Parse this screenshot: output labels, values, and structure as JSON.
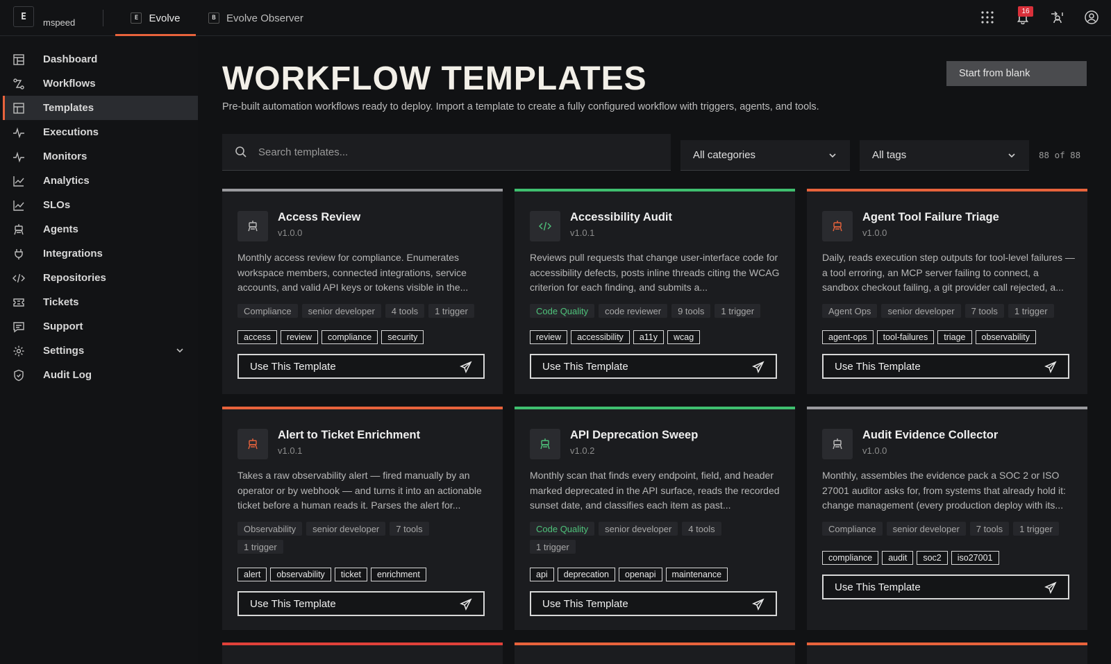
{
  "topbar": {
    "logo_text": "E",
    "org": "mspeed",
    "tabs": [
      {
        "label": "Evolve",
        "active": true
      },
      {
        "label": "Evolve Observer",
        "active": false
      }
    ],
    "notification_count": "16",
    "icons": [
      "apps-grid-icon",
      "bell-icon",
      "switch-user-icon",
      "account-icon"
    ]
  },
  "sidebar": {
    "items": [
      {
        "label": "Dashboard",
        "icon": "dashboard-icon"
      },
      {
        "label": "Workflows",
        "icon": "workflows-icon"
      },
      {
        "label": "Templates",
        "icon": "templates-icon",
        "active": true
      },
      {
        "label": "Executions",
        "icon": "pulse-icon"
      },
      {
        "label": "Monitors",
        "icon": "monitor-pulse-icon"
      },
      {
        "label": "Analytics",
        "icon": "chart-line-icon"
      },
      {
        "label": "SLOs",
        "icon": "chart-line-icon"
      },
      {
        "label": "Agents",
        "icon": "robot-icon"
      },
      {
        "label": "Integrations",
        "icon": "plug-icon"
      },
      {
        "label": "Repositories",
        "icon": "code-icon"
      },
      {
        "label": "Tickets",
        "icon": "ticket-icon"
      },
      {
        "label": "Support",
        "icon": "chat-icon"
      },
      {
        "label": "Settings",
        "icon": "gear-icon",
        "expandable": true
      },
      {
        "label": "Audit Log",
        "icon": "shield-icon"
      }
    ]
  },
  "page": {
    "title": "WORKFLOW TEMPLATES",
    "subtitle": "Pre-built automation workflows ready to deploy. Import a template to create a fully configured workflow with triggers, agents, and tools.",
    "start_blank": "Start from blank",
    "search_placeholder": "Search templates...",
    "category_select": "All categories",
    "tag_select": "All tags",
    "count": "88 of 88"
  },
  "cards": [
    {
      "title": "Access Review",
      "version": "v1.0.0",
      "accent": "#9a9a9e",
      "icon": "robot-icon",
      "icon_color": "#bdbdbd",
      "description": "Monthly access review for compliance. Enumerates workspace members, connected integrations, service accounts, and valid API keys or tokens visible in the...",
      "meta": [
        {
          "text": "Compliance"
        },
        {
          "text": "senior developer"
        },
        {
          "text": "4 tools"
        },
        {
          "text": "1 trigger"
        }
      ],
      "tags": [
        "access",
        "review",
        "compliance",
        "security"
      ],
      "button": "Use This Template"
    },
    {
      "title": "Accessibility Audit",
      "version": "v1.0.1",
      "accent": "#3fbf6f",
      "icon": "code-icon",
      "icon_color": "#4ec27a",
      "description": "Reviews pull requests that change user-interface code for accessibility defects, posts inline threads citing the WCAG criterion for each finding, and submits a...",
      "meta": [
        {
          "text": "Code Quality",
          "green": true
        },
        {
          "text": "code reviewer"
        },
        {
          "text": "9 tools"
        },
        {
          "text": "1 trigger"
        }
      ],
      "tags": [
        "review",
        "accessibility",
        "a11y",
        "wcag"
      ],
      "button": "Use This Template"
    },
    {
      "title": "Agent Tool Failure Triage",
      "version": "v1.0.0",
      "accent": "#e8633c",
      "icon": "robot-icon",
      "icon_color": "#e8633c",
      "description": "Daily, reads execution step outputs for tool-level failures — a tool erroring, an MCP server failing to connect, a sandbox checkout failing, a git provider call rejected, a...",
      "meta": [
        {
          "text": "Agent Ops"
        },
        {
          "text": "senior developer"
        },
        {
          "text": "7 tools"
        },
        {
          "text": "1 trigger"
        }
      ],
      "tags": [
        "agent-ops",
        "tool-failures",
        "triage",
        "observability"
      ],
      "button": "Use This Template"
    },
    {
      "title": "Alert to Ticket Enrichment",
      "version": "v1.0.1",
      "accent": "#e8633c",
      "icon": "robot-icon",
      "icon_color": "#e8633c",
      "description": "Takes a raw observability alert — fired manually by an operator or by webhook — and turns it into an actionable ticket before a human reads it. Parses the alert for...",
      "meta": [
        {
          "text": "Observability"
        },
        {
          "text": "senior developer"
        },
        {
          "text": "7 tools"
        },
        {
          "text": "1 trigger"
        }
      ],
      "tags": [
        "alert",
        "observability",
        "ticket",
        "enrichment"
      ],
      "button": "Use This Template"
    },
    {
      "title": "API Deprecation Sweep",
      "version": "v1.0.2",
      "accent": "#3fbf6f",
      "icon": "robot-icon",
      "icon_color": "#4ec27a",
      "description": "Monthly scan that finds every endpoint, field, and header marked deprecated in the API surface, reads the recorded sunset date, and classifies each item as past...",
      "meta": [
        {
          "text": "Code Quality",
          "green": true
        },
        {
          "text": "senior developer"
        },
        {
          "text": "4 tools"
        },
        {
          "text": "1 trigger"
        }
      ],
      "tags": [
        "api",
        "deprecation",
        "openapi",
        "maintenance"
      ],
      "button": "Use This Template"
    },
    {
      "title": "Audit Evidence Collector",
      "version": "v1.0.0",
      "accent": "#9a9a9e",
      "icon": "robot-icon",
      "icon_color": "#bdbdbd",
      "description": "Monthly, assembles the evidence pack a SOC 2 or ISO 27001 auditor asks for, from systems that already hold it: change management (every production deploy with its...",
      "meta": [
        {
          "text": "Compliance"
        },
        {
          "text": "senior developer"
        },
        {
          "text": "7 tools"
        },
        {
          "text": "1 trigger"
        }
      ],
      "tags": [
        "compliance",
        "audit",
        "soc2",
        "iso27001"
      ],
      "button": "Use This Template"
    }
  ],
  "partial_row_accents": [
    "#e0413a",
    "#e8633c",
    "#e8633c"
  ]
}
